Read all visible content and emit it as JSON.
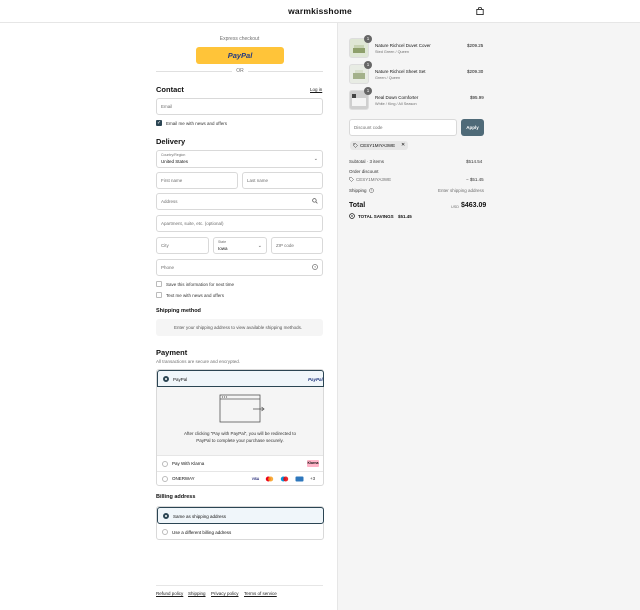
{
  "header": {
    "brand": "warmkisshome",
    "cart_icon": "bag-icon"
  },
  "express": {
    "title": "Express checkout",
    "paypal_label": "PayPal",
    "or": "OR"
  },
  "contact": {
    "heading": "Contact",
    "login": "Log in",
    "email_placeholder": "Email",
    "email_news": "Email me with news and offers",
    "email_news_checked": true
  },
  "delivery": {
    "heading": "Delivery",
    "country_label": "Country/Region",
    "country_value": "United States",
    "first_name": "First name",
    "last_name": "Last name",
    "address": "Address",
    "apartment": "Apartment, suite, etc. (optional)",
    "city": "City",
    "state_label": "State",
    "state_value": "Iowa",
    "zip": "ZIP code",
    "phone": "Phone",
    "save_info": "Save this information for next time",
    "text_news": "Text me with news and offers"
  },
  "shipping": {
    "heading": "Shipping method",
    "notice": "Enter your shipping address to view available shipping methods."
  },
  "payment": {
    "heading": "Payment",
    "subtitle": "All transactions are secure and encrypted.",
    "paypal": "PayPal",
    "paypal_logo": "PayPal",
    "redirect_text": "After clicking “Pay with PayPal”, you will be redirected to PayPal to complete your purchase securely.",
    "klarna": "Pay With Klarna",
    "klarna_logo": "Klarna",
    "onerway": "ONERWAY",
    "cards": [
      "VISA",
      "MC",
      "MAE",
      "AMEX"
    ],
    "cards_more": "+3",
    "card_colors": [
      "#1a1f71",
      "#eb001b",
      "#0099df",
      "#2e77bc"
    ]
  },
  "billing": {
    "heading": "Billing address",
    "same": "Same as shipping address",
    "different": "Use a different billing address"
  },
  "footer": {
    "links": [
      "Refund policy",
      "Shipping",
      "Privacy policy",
      "Terms of service"
    ]
  },
  "summary": {
    "items": [
      {
        "name": "Nature Richcel Duvet Cover",
        "variant": "Sted Green / Queen",
        "price": "$209.25",
        "qty": "1"
      },
      {
        "name": "Nature Richcel Sheet Set",
        "variant": "Green / Queen",
        "price": "$209.30",
        "qty": "1"
      },
      {
        "name": "Real Down Comforter",
        "variant": "White / King / All Season",
        "price": "$95.99",
        "qty": "1"
      }
    ],
    "discount_placeholder": "Discount code",
    "apply": "Apply",
    "code": "CESY1MIYA3WE",
    "subtotal_label": "Subtotal · 3 items",
    "subtotal": "$514.54",
    "order_discount_label": "Order discount",
    "order_discount_code": "CESY1MIYA3WE",
    "order_discount_value": "− $51.45",
    "shipping_label": "Shipping",
    "shipping_value": "Enter shipping address",
    "total_label": "Total",
    "currency": "USD",
    "total": "$463.09",
    "savings_label": "TOTAL SAVINGS",
    "savings": "$51.45",
    "accent": "#4f6a78"
  }
}
